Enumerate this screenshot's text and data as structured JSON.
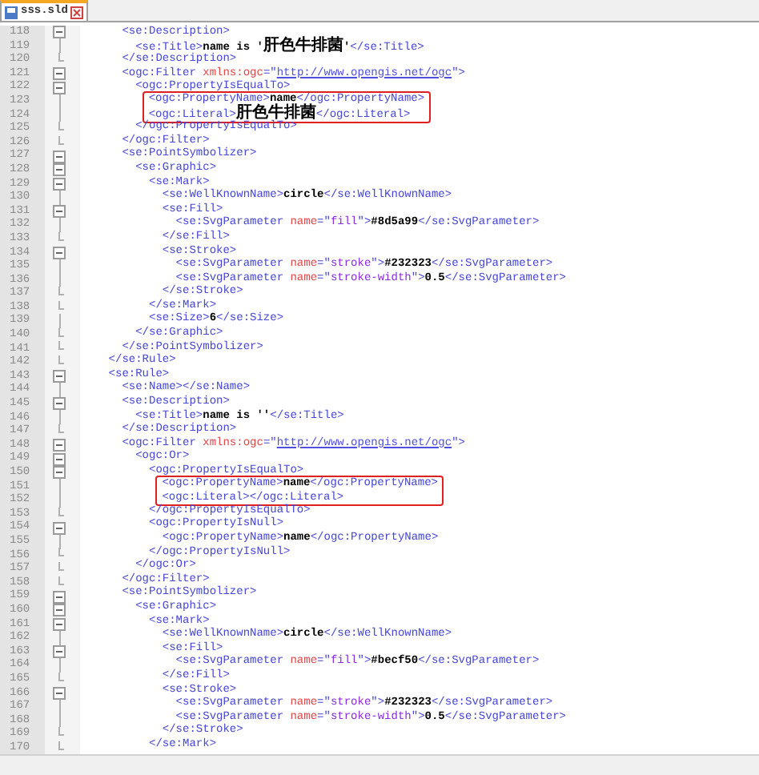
{
  "tab": {
    "label": "sss.sld",
    "selected": true
  },
  "lines": [
    {
      "number": "118",
      "kind": "open",
      "highlighted": false,
      "segments": [
        {
          "kind": "tag",
          "text": "      <se:Description>"
        }
      ]
    },
    {
      "number": "119",
      "kind": "line",
      "highlighted": false,
      "segments": [
        {
          "kind": "tag",
          "text": "        <se:Title>"
        },
        {
          "kind": "text",
          "text": "name is '"
        },
        {
          "kind": "cjk",
          "text": "肝色牛排菌"
        },
        {
          "kind": "text",
          "text": "'"
        },
        {
          "kind": "tag",
          "text": "</se:Title>"
        }
      ]
    },
    {
      "number": "120",
      "kind": "end",
      "highlighted": false,
      "segments": [
        {
          "kind": "tag",
          "text": "      </se:Description>"
        }
      ]
    },
    {
      "number": "121",
      "kind": "open",
      "highlighted": false,
      "segments": [
        {
          "kind": "tag",
          "text": "      <ogc:Filter "
        },
        {
          "kind": "attr",
          "text": "xmlns:ogc"
        },
        {
          "kind": "tag",
          "text": "=\""
        },
        {
          "kind": "link",
          "text": "http://www.opengis.net/ogc"
        },
        {
          "kind": "tag",
          "text": "\">"
        }
      ]
    },
    {
      "number": "122",
      "kind": "open",
      "highlighted": false,
      "segments": [
        {
          "kind": "tag",
          "text": "        <ogc:PropertyIsEqualTo>"
        }
      ]
    },
    {
      "number": "123",
      "kind": "line",
      "highlighted": true,
      "segments": [
        {
          "kind": "tag",
          "text": "<ogc:PropertyName>"
        },
        {
          "kind": "text",
          "text": "name"
        },
        {
          "kind": "tag",
          "text": "</ogc:PropertyName>"
        }
      ]
    },
    {
      "number": "124",
      "kind": "line",
      "highlighted": true,
      "segments": [
        {
          "kind": "tag",
          "text": "<ogc:Literal>"
        },
        {
          "kind": "cjk",
          "text": "肝色牛排菌"
        },
        {
          "kind": "tag",
          "text": "</ogc:Literal>"
        }
      ]
    },
    {
      "number": "125",
      "kind": "end",
      "highlighted": false,
      "segments": [
        {
          "kind": "tag",
          "text": "        </ogc:PropertyIsEqualTo>"
        }
      ]
    },
    {
      "number": "126",
      "kind": "end",
      "highlighted": false,
      "segments": [
        {
          "kind": "tag",
          "text": "      </ogc:Filter>"
        }
      ]
    },
    {
      "number": "127",
      "kind": "open",
      "highlighted": false,
      "segments": [
        {
          "kind": "tag",
          "text": "      <se:PointSymbolizer>"
        }
      ]
    },
    {
      "number": "128",
      "kind": "open",
      "highlighted": false,
      "segments": [
        {
          "kind": "tag",
          "text": "        <se:Graphic>"
        }
      ]
    },
    {
      "number": "129",
      "kind": "open",
      "highlighted": false,
      "segments": [
        {
          "kind": "tag",
          "text": "          <se:Mark>"
        }
      ]
    },
    {
      "number": "130",
      "kind": "line",
      "highlighted": false,
      "segments": [
        {
          "kind": "tag",
          "text": "            <se:WellKnownName>"
        },
        {
          "kind": "text",
          "text": "circle"
        },
        {
          "kind": "tag",
          "text": "</se:WellKnownName>"
        }
      ]
    },
    {
      "number": "131",
      "kind": "open",
      "highlighted": false,
      "segments": [
        {
          "kind": "tag",
          "text": "            <se:Fill>"
        }
      ]
    },
    {
      "number": "132",
      "kind": "line",
      "highlighted": false,
      "segments": [
        {
          "kind": "tag",
          "text": "              <se:SvgParameter "
        },
        {
          "kind": "attr",
          "text": "name"
        },
        {
          "kind": "tag",
          "text": "=\""
        },
        {
          "kind": "value",
          "text": "fill"
        },
        {
          "kind": "tag",
          "text": "\">"
        },
        {
          "kind": "text",
          "text": "#8d5a99"
        },
        {
          "kind": "tag",
          "text": "</se:SvgParameter>"
        }
      ]
    },
    {
      "number": "133",
      "kind": "end",
      "highlighted": false,
      "segments": [
        {
          "kind": "tag",
          "text": "            </se:Fill>"
        }
      ]
    },
    {
      "number": "134",
      "kind": "open",
      "highlighted": false,
      "segments": [
        {
          "kind": "tag",
          "text": "            <se:Stroke>"
        }
      ]
    },
    {
      "number": "135",
      "kind": "line",
      "highlighted": false,
      "segments": [
        {
          "kind": "tag",
          "text": "              <se:SvgParameter "
        },
        {
          "kind": "attr",
          "text": "name"
        },
        {
          "kind": "tag",
          "text": "=\""
        },
        {
          "kind": "value",
          "text": "stroke"
        },
        {
          "kind": "tag",
          "text": "\">"
        },
        {
          "kind": "text",
          "text": "#232323"
        },
        {
          "kind": "tag",
          "text": "</se:SvgParameter>"
        }
      ]
    },
    {
      "number": "136",
      "kind": "line",
      "highlighted": false,
      "segments": [
        {
          "kind": "tag",
          "text": "              <se:SvgParameter "
        },
        {
          "kind": "attr",
          "text": "name"
        },
        {
          "kind": "tag",
          "text": "=\""
        },
        {
          "kind": "value",
          "text": "stroke-width"
        },
        {
          "kind": "tag",
          "text": "\">"
        },
        {
          "kind": "text",
          "text": "0.5"
        },
        {
          "kind": "tag",
          "text": "</se:SvgParameter>"
        }
      ]
    },
    {
      "number": "137",
      "kind": "end",
      "highlighted": false,
      "segments": [
        {
          "kind": "tag",
          "text": "            </se:Stroke>"
        }
      ]
    },
    {
      "number": "138",
      "kind": "end",
      "highlighted": false,
      "segments": [
        {
          "kind": "tag",
          "text": "          </se:Mark>"
        }
      ]
    },
    {
      "number": "139",
      "kind": "line",
      "highlighted": false,
      "segments": [
        {
          "kind": "tag",
          "text": "          <se:Size>"
        },
        {
          "kind": "text",
          "text": "6"
        },
        {
          "kind": "tag",
          "text": "</se:Size>"
        }
      ]
    },
    {
      "number": "140",
      "kind": "end",
      "highlighted": false,
      "segments": [
        {
          "kind": "tag",
          "text": "        </se:Graphic>"
        }
      ]
    },
    {
      "number": "141",
      "kind": "end",
      "highlighted": false,
      "segments": [
        {
          "kind": "tag",
          "text": "      </se:PointSymbolizer>"
        }
      ]
    },
    {
      "number": "142",
      "kind": "end",
      "highlighted": false,
      "segments": [
        {
          "kind": "tag",
          "text": "    </se:Rule>"
        }
      ]
    },
    {
      "number": "143",
      "kind": "open",
      "highlighted": false,
      "segments": [
        {
          "kind": "tag",
          "text": "    <se:Rule>"
        }
      ]
    },
    {
      "number": "144",
      "kind": "line",
      "highlighted": false,
      "segments": [
        {
          "kind": "tag",
          "text": "      <se:Name></se:Name>"
        }
      ]
    },
    {
      "number": "145",
      "kind": "open",
      "highlighted": false,
      "segments": [
        {
          "kind": "tag",
          "text": "      <se:Description>"
        }
      ]
    },
    {
      "number": "146",
      "kind": "line",
      "highlighted": false,
      "segments": [
        {
          "kind": "tag",
          "text": "        <se:Title>"
        },
        {
          "kind": "text",
          "text": "name is ''"
        },
        {
          "kind": "tag",
          "text": "</se:Title>"
        }
      ]
    },
    {
      "number": "147",
      "kind": "end",
      "highlighted": false,
      "segments": [
        {
          "kind": "tag",
          "text": "      </se:Description>"
        }
      ]
    },
    {
      "number": "148",
      "kind": "open",
      "highlighted": false,
      "segments": [
        {
          "kind": "tag",
          "text": "      <ogc:Filter "
        },
        {
          "kind": "attr",
          "text": "xmlns:ogc"
        },
        {
          "kind": "tag",
          "text": "=\""
        },
        {
          "kind": "link",
          "text": "http://www.opengis.net/ogc"
        },
        {
          "kind": "tag",
          "text": "\">"
        }
      ]
    },
    {
      "number": "149",
      "kind": "open",
      "highlighted": false,
      "segments": [
        {
          "kind": "tag",
          "text": "        <ogc:Or>"
        }
      ]
    },
    {
      "number": "150",
      "kind": "open",
      "highlighted": false,
      "segments": [
        {
          "kind": "tag",
          "text": "          <ogc:PropertyIsEqualTo>"
        }
      ]
    },
    {
      "number": "151",
      "kind": "line",
      "highlighted": true,
      "segments": [
        {
          "kind": "tag",
          "text": "<ogc:PropertyName>"
        },
        {
          "kind": "text",
          "text": "name"
        },
        {
          "kind": "tag",
          "text": "</ogc:PropertyName>"
        }
      ]
    },
    {
      "number": "152",
      "kind": "line",
      "highlighted": true,
      "segments": [
        {
          "kind": "tag",
          "text": "<ogc:Literal></ogc:Literal>"
        }
      ]
    },
    {
      "number": "153",
      "kind": "end",
      "highlighted": false,
      "segments": [
        {
          "kind": "tag",
          "text": "          </ogc:PropertyIsEqualTo>"
        }
      ]
    },
    {
      "number": "154",
      "kind": "open",
      "highlighted": false,
      "segments": [
        {
          "kind": "tag",
          "text": "          <ogc:PropertyIsNull>"
        }
      ]
    },
    {
      "number": "155",
      "kind": "line",
      "highlighted": false,
      "segments": [
        {
          "kind": "tag",
          "text": "            <ogc:PropertyName>"
        },
        {
          "kind": "text",
          "text": "name"
        },
        {
          "kind": "tag",
          "text": "</ogc:PropertyName>"
        }
      ]
    },
    {
      "number": "156",
      "kind": "end",
      "highlighted": false,
      "segments": [
        {
          "kind": "tag",
          "text": "          </ogc:PropertyIsNull>"
        }
      ]
    },
    {
      "number": "157",
      "kind": "end",
      "highlighted": false,
      "segments": [
        {
          "kind": "tag",
          "text": "        </ogc:Or>"
        }
      ]
    },
    {
      "number": "158",
      "kind": "end",
      "highlighted": false,
      "segments": [
        {
          "kind": "tag",
          "text": "      </ogc:Filter>"
        }
      ]
    },
    {
      "number": "159",
      "kind": "open",
      "highlighted": false,
      "segments": [
        {
          "kind": "tag",
          "text": "      <se:PointSymbolizer>"
        }
      ]
    },
    {
      "number": "160",
      "kind": "open",
      "highlighted": false,
      "segments": [
        {
          "kind": "tag",
          "text": "        <se:Graphic>"
        }
      ]
    },
    {
      "number": "161",
      "kind": "open",
      "highlighted": false,
      "segments": [
        {
          "kind": "tag",
          "text": "          <se:Mark>"
        }
      ]
    },
    {
      "number": "162",
      "kind": "line",
      "highlighted": false,
      "segments": [
        {
          "kind": "tag",
          "text": "            <se:WellKnownName>"
        },
        {
          "kind": "text",
          "text": "circle"
        },
        {
          "kind": "tag",
          "text": "</se:WellKnownName>"
        }
      ]
    },
    {
      "number": "163",
      "kind": "open",
      "highlighted": false,
      "segments": [
        {
          "kind": "tag",
          "text": "            <se:Fill>"
        }
      ]
    },
    {
      "number": "164",
      "kind": "line",
      "highlighted": false,
      "segments": [
        {
          "kind": "tag",
          "text": "              <se:SvgParameter "
        },
        {
          "kind": "attr",
          "text": "name"
        },
        {
          "kind": "tag",
          "text": "=\""
        },
        {
          "kind": "value",
          "text": "fill"
        },
        {
          "kind": "tag",
          "text": "\">"
        },
        {
          "kind": "text",
          "text": "#becf50"
        },
        {
          "kind": "tag",
          "text": "</se:SvgParameter>"
        }
      ]
    },
    {
      "number": "165",
      "kind": "end",
      "highlighted": false,
      "segments": [
        {
          "kind": "tag",
          "text": "            </se:Fill>"
        }
      ]
    },
    {
      "number": "166",
      "kind": "open",
      "highlighted": false,
      "segments": [
        {
          "kind": "tag",
          "text": "            <se:Stroke>"
        }
      ]
    },
    {
      "number": "167",
      "kind": "line",
      "highlighted": false,
      "segments": [
        {
          "kind": "tag",
          "text": "              <se:SvgParameter "
        },
        {
          "kind": "attr",
          "text": "name"
        },
        {
          "kind": "tag",
          "text": "=\""
        },
        {
          "kind": "value",
          "text": "stroke"
        },
        {
          "kind": "tag",
          "text": "\">"
        },
        {
          "kind": "text",
          "text": "#232323"
        },
        {
          "kind": "tag",
          "text": "</se:SvgParameter>"
        }
      ]
    },
    {
      "number": "168",
      "kind": "line",
      "highlighted": false,
      "segments": [
        {
          "kind": "tag",
          "text": "              <se:SvgParameter "
        },
        {
          "kind": "attr",
          "text": "name"
        },
        {
          "kind": "tag",
          "text": "=\""
        },
        {
          "kind": "value",
          "text": "stroke-width"
        },
        {
          "kind": "tag",
          "text": "\">"
        },
        {
          "kind": "text",
          "text": "0.5"
        },
        {
          "kind": "tag",
          "text": "</se:SvgParameter>"
        }
      ]
    },
    {
      "number": "169",
      "kind": "end",
      "highlighted": false,
      "segments": [
        {
          "kind": "tag",
          "text": "            </se:Stroke>"
        }
      ]
    },
    {
      "number": "170",
      "kind": "end",
      "highlighted": false,
      "segments": [
        {
          "kind": "tag",
          "text": "          </se:Mark>"
        }
      ]
    }
  ]
}
